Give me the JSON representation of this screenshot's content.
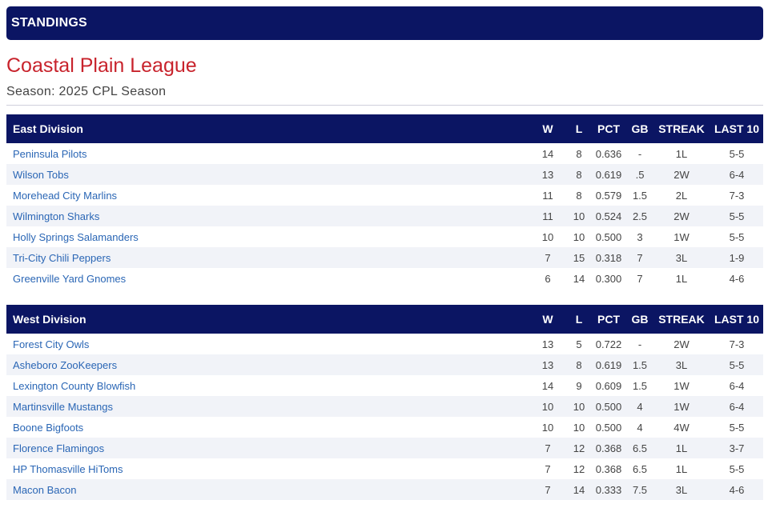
{
  "header": {
    "title": "STANDINGS"
  },
  "league": {
    "name": "Coastal Plain League",
    "season_line": "Season: 2025 CPL Season"
  },
  "columns": {
    "w": "W",
    "l": "L",
    "pct": "PCT",
    "gb": "GB",
    "streak": "STREAK",
    "last10": "LAST 10"
  },
  "divisions": [
    {
      "name": "East Division",
      "teams": [
        {
          "team": "Peninsula Pilots",
          "w": "14",
          "l": "8",
          "pct": "0.636",
          "gb": "-",
          "streak": "1L",
          "last10": "5-5"
        },
        {
          "team": "Wilson Tobs",
          "w": "13",
          "l": "8",
          "pct": "0.619",
          "gb": ".5",
          "streak": "2W",
          "last10": "6-4"
        },
        {
          "team": "Morehead City Marlins",
          "w": "11",
          "l": "8",
          "pct": "0.579",
          "gb": "1.5",
          "streak": "2L",
          "last10": "7-3"
        },
        {
          "team": "Wilmington Sharks",
          "w": "11",
          "l": "10",
          "pct": "0.524",
          "gb": "2.5",
          "streak": "2W",
          "last10": "5-5"
        },
        {
          "team": "Holly Springs Salamanders",
          "w": "10",
          "l": "10",
          "pct": "0.500",
          "gb": "3",
          "streak": "1W",
          "last10": "5-5"
        },
        {
          "team": "Tri-City Chili Peppers",
          "w": "7",
          "l": "15",
          "pct": "0.318",
          "gb": "7",
          "streak": "3L",
          "last10": "1-9"
        },
        {
          "team": "Greenville Yard Gnomes",
          "w": "6",
          "l": "14",
          "pct": "0.300",
          "gb": "7",
          "streak": "1L",
          "last10": "4-6"
        }
      ]
    },
    {
      "name": "West Division",
      "teams": [
        {
          "team": "Forest City Owls",
          "w": "13",
          "l": "5",
          "pct": "0.722",
          "gb": "-",
          "streak": "2W",
          "last10": "7-3"
        },
        {
          "team": "Asheboro ZooKeepers",
          "w": "13",
          "l": "8",
          "pct": "0.619",
          "gb": "1.5",
          "streak": "3L",
          "last10": "5-5"
        },
        {
          "team": "Lexington County Blowfish",
          "w": "14",
          "l": "9",
          "pct": "0.609",
          "gb": "1.5",
          "streak": "1W",
          "last10": "6-4"
        },
        {
          "team": "Martinsville Mustangs",
          "w": "10",
          "l": "10",
          "pct": "0.500",
          "gb": "4",
          "streak": "1W",
          "last10": "6-4"
        },
        {
          "team": "Boone Bigfoots",
          "w": "10",
          "l": "10",
          "pct": "0.500",
          "gb": "4",
          "streak": "4W",
          "last10": "5-5"
        },
        {
          "team": "Florence Flamingos",
          "w": "7",
          "l": "12",
          "pct": "0.368",
          "gb": "6.5",
          "streak": "1L",
          "last10": "3-7"
        },
        {
          "team": "HP Thomasville HiToms",
          "w": "7",
          "l": "12",
          "pct": "0.368",
          "gb": "6.5",
          "streak": "1L",
          "last10": "5-5"
        },
        {
          "team": "Macon Bacon",
          "w": "7",
          "l": "14",
          "pct": "0.333",
          "gb": "7.5",
          "streak": "3L",
          "last10": "4-6"
        }
      ]
    }
  ],
  "colors": {
    "header_bg": "#0b1563",
    "title_red": "#c8232c",
    "link_blue": "#2a66b5",
    "stripe": "#f1f3f8"
  }
}
